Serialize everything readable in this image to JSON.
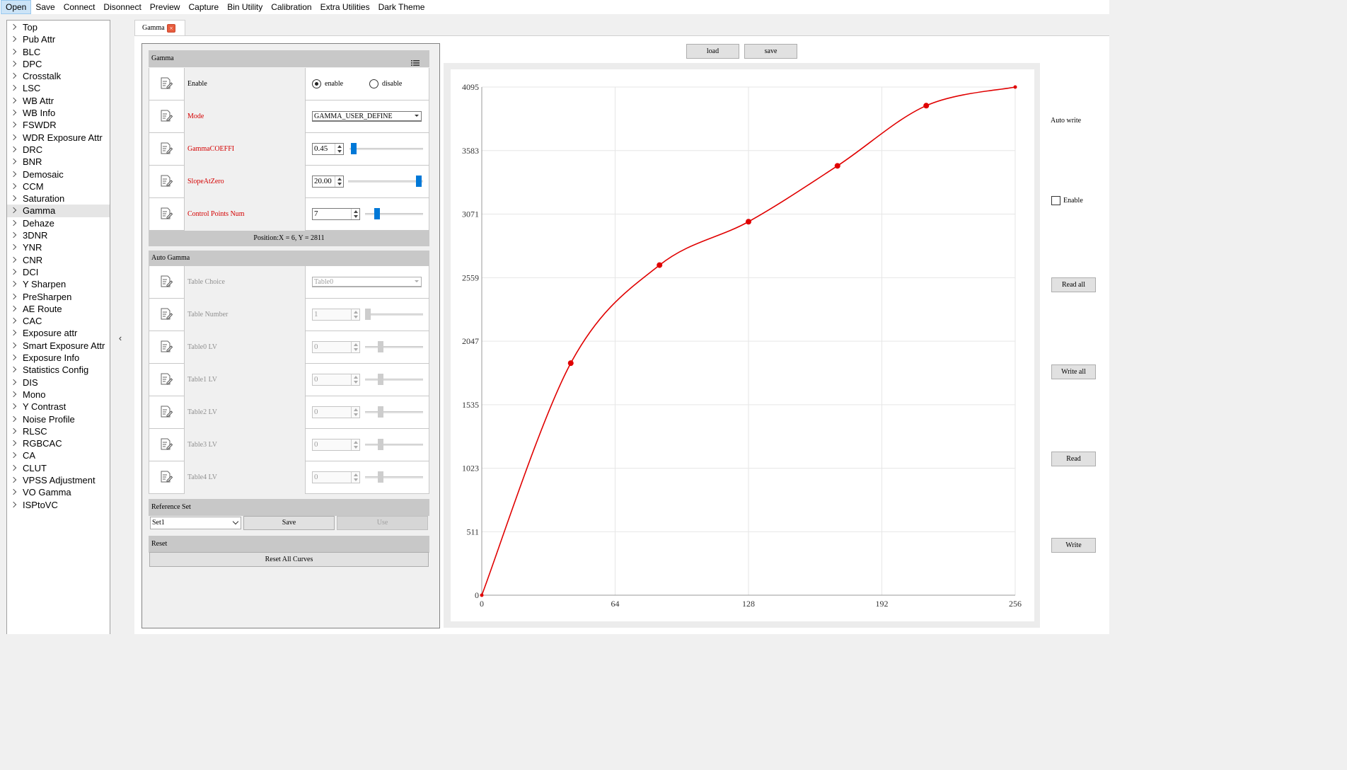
{
  "menu": [
    "Open",
    "Save",
    "Connect",
    "Disonnect",
    "Preview",
    "Capture",
    "Bin Utility",
    "Calibration",
    "Extra Utilities",
    "Dark Theme"
  ],
  "sidebar": {
    "items": [
      "Top",
      "Pub Attr",
      "BLC",
      "DPC",
      "Crosstalk",
      "LSC",
      "WB Attr",
      "WB Info",
      "FSWDR",
      "WDR Exposure Attr",
      "DRC",
      "BNR",
      "Demosaic",
      "CCM",
      "Saturation",
      "Gamma",
      "Dehaze",
      "3DNR",
      "YNR",
      "CNR",
      "DCI",
      "Y Sharpen",
      "PreSharpen",
      "AE Route",
      "CAC",
      "Exposure attr",
      "Smart Exposure Attr",
      "Exposure Info",
      "Statistics Config",
      "DIS",
      "Mono",
      "Y Contrast",
      "Noise Profile",
      "RLSC",
      "RGBCAC",
      "CA",
      "CLUT",
      "VPSS Adjustment",
      "VO Gamma",
      "ISPtoVC"
    ],
    "selected": "Gamma"
  },
  "tab": {
    "label": "Gamma",
    "close": "×"
  },
  "gamma_group": {
    "title": "Gamma",
    "enable": {
      "label": "Enable",
      "opt_enable": "enable",
      "opt_disable": "disable",
      "selected": "enable"
    },
    "mode": {
      "label": "Mode",
      "value": "GAMMA_USER_DEFINE"
    },
    "coeff": {
      "label": "GammaCOEFFI",
      "value": "0.45",
      "slider": 0.0
    },
    "slope": {
      "label": "SlopeAtZero",
      "value": "20.00",
      "slider": 1.0
    },
    "cpnum": {
      "label": "Control Points Num",
      "value": "7",
      "slider": 0.2
    },
    "position": "Position:X = 6, Y = 2811"
  },
  "auto_gamma": {
    "title": "Auto Gamma",
    "table_choice": {
      "label": "Table Choice",
      "value": "Table0"
    },
    "table_number": {
      "label": "Table Number",
      "value": "1"
    },
    "lv_rows": [
      {
        "label": "Table0 LV",
        "value": "0"
      },
      {
        "label": "Table1 LV",
        "value": "0"
      },
      {
        "label": "Table2 LV",
        "value": "0"
      },
      {
        "label": "Table3 LV",
        "value": "0"
      },
      {
        "label": "Table4 LV",
        "value": "0"
      }
    ]
  },
  "reference_set": {
    "title": "Reference Set",
    "select": "Set1",
    "save": "Save",
    "use": "Use"
  },
  "reset": {
    "title": "Reset",
    "button": "Reset All Curves"
  },
  "chart_buttons": {
    "load": "load",
    "save": "save"
  },
  "right": {
    "auto_write": "Auto write",
    "enable": "Enable",
    "read_all": "Read all",
    "write_all": "Write all",
    "read": "Read",
    "write": "Write"
  },
  "colors": {
    "curve": "#e00000",
    "accent": "#0078d7"
  },
  "chart_data": {
    "type": "line",
    "x_ticks": [
      "0",
      "64",
      "128",
      "192",
      "256"
    ],
    "y_ticks": [
      "0",
      "511",
      "1023",
      "1535",
      "2047",
      "2559",
      "3071",
      "3583",
      "4095"
    ],
    "xlim": [
      0,
      256
    ],
    "ylim": [
      0,
      4095
    ],
    "control_points": [
      [
        0,
        0
      ],
      [
        42.7,
        1870
      ],
      [
        85.3,
        2660
      ],
      [
        128,
        3010
      ],
      [
        170.7,
        3460
      ],
      [
        213.3,
        3945
      ],
      [
        256,
        4095
      ]
    ],
    "grid": true
  }
}
